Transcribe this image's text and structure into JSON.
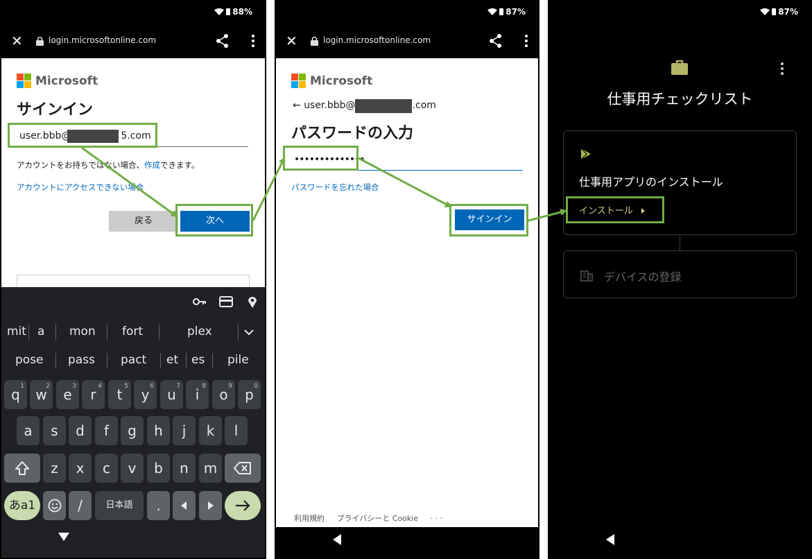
{
  "screen1": {
    "battery": "88%",
    "url": "login.microsoftonline.com",
    "brand": "Microsoft",
    "title": "サインイン",
    "email_prefix": "user.bbb@",
    "email_suffix": "5.com",
    "no_account_text": "アカウントをお持ちではない場合、",
    "create_link": "作成",
    "create_suffix": "できます。",
    "cant_access_link": "アカウントにアクセスできない場合",
    "back_label": "戻る",
    "next_label": "次へ"
  },
  "keyboard": {
    "suggestions_row1": [
      "mit",
      "a",
      "mon",
      "fort",
      "plex"
    ],
    "suggestions_row2": [
      "pose",
      "pass",
      "pact",
      "et",
      "es",
      "pile"
    ],
    "row1": [
      "q",
      "w",
      "e",
      "r",
      "t",
      "y",
      "u",
      "i",
      "o",
      "p"
    ],
    "row1_num": [
      "1",
      "2",
      "3",
      "4",
      "5",
      "6",
      "7",
      "8",
      "9",
      "0"
    ],
    "row2": [
      "a",
      "s",
      "d",
      "f",
      "g",
      "h",
      "j",
      "k",
      "l"
    ],
    "row3": [
      "z",
      "x",
      "c",
      "v",
      "b",
      "n",
      "m"
    ],
    "lang_key": "あa1",
    "slash_key": "/",
    "space_key": "日本語",
    "dot_key": "."
  },
  "screen2": {
    "battery": "87%",
    "url": "login.microsoftonline.com",
    "brand": "Microsoft",
    "back_email_prefix": "user.bbb@",
    "back_email_suffix": ".com",
    "title": "パスワードの入力",
    "password_mask": "••••••••••••••",
    "forgot_link": "パスワードを忘れた場合",
    "signin_label": "サインイン",
    "footer_terms": "利用規約",
    "footer_privacy": "プライバシーと Cookie",
    "footer_more": "· · ·"
  },
  "screen3": {
    "battery": "87%",
    "title": "仕事用チェックリスト",
    "card1_title": "仕事用アプリのインストール",
    "install_label": "インストール",
    "card2_title": "デバイスの登録"
  },
  "colors": {
    "ms_blue": "#0067b8",
    "highlight_green": "#70ad47"
  }
}
